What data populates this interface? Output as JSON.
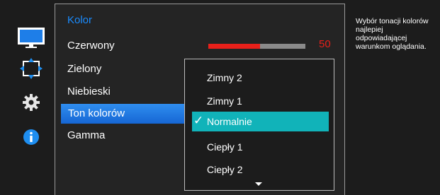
{
  "menu": {
    "title": "Kolor",
    "items": [
      "Czerwony",
      "Zielony",
      "Niebieski",
      "Ton kolorów",
      "Gamma"
    ],
    "selected_index": 3
  },
  "slider": {
    "value": "50",
    "fill_fraction": 0.53
  },
  "dropdown": {
    "options": [
      "Zimny 2",
      "Zimny 1",
      "Normalnie",
      "Ciepły 1",
      "Ciepły 2"
    ],
    "selected": "Normalnie",
    "check_glyph": "✓"
  },
  "help": {
    "text": "Wybór tonacji kolorów\nnajlepiej\nodpowiadającej\nwarunkom oglądania."
  },
  "icons": [
    "monitor-icon",
    "move-arrows-icon",
    "gear-icon",
    "info-icon"
  ],
  "colors": {
    "accent_blue": "#1a8cff",
    "selected_item": "#1a78e0",
    "selected_option": "#11b3b9",
    "slider_red": "#e8201a",
    "background": "#1c1c1c"
  }
}
